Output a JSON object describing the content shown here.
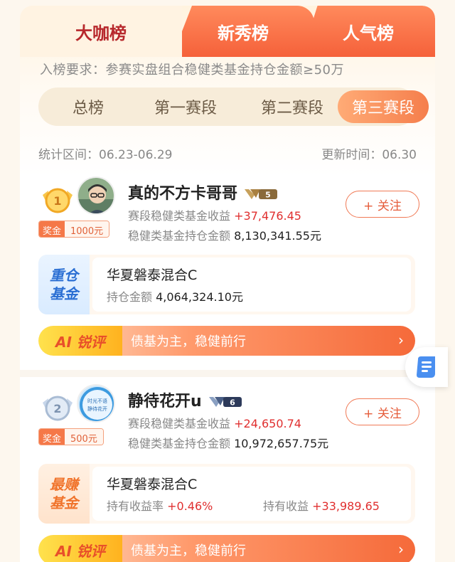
{
  "tabs": [
    {
      "label": "大咖榜",
      "active": true
    },
    {
      "label": "新秀榜",
      "active": false
    },
    {
      "label": "人气榜",
      "active": false
    }
  ],
  "requirement": "入榜要求：参赛实盘组合稳健类基金持仓金额≥50万",
  "segments": [
    "总榜",
    "第一赛段",
    "第二赛段",
    "第三赛段"
  ],
  "active_segment": "第三赛段",
  "stats": {
    "period": "统计区间：06.23-06.29",
    "updated": "更新时间：06.30"
  },
  "entries": [
    {
      "rank": "1",
      "prize_label": "奖金",
      "prize_amount": "1000元",
      "name": "真的不方卡哥哥",
      "level": "5",
      "return_label": "赛段稳健类基金收益",
      "return_value": "+37,476.45",
      "holding_label": "稳健类基金持仓金额",
      "holding_value": "8,130,341.55元",
      "follow_label": "+ 关注",
      "fund_tag": [
        "重仓",
        "基金"
      ],
      "fund_name": "华夏磐泰混合C",
      "fund_sub_label": "持仓金额",
      "fund_sub_value": "4,064,324.10元",
      "ai_tag": "AI 锐评",
      "ai_text": "债基为主，稳健前行"
    },
    {
      "rank": "2",
      "prize_label": "奖金",
      "prize_amount": "500元",
      "name": "静待花开u",
      "level": "6",
      "avatar_text": [
        "时光不语",
        "静待花开"
      ],
      "return_label": "赛段稳健类基金收益",
      "return_value": "+24,650.74",
      "holding_label": "稳健类基金持仓金额",
      "holding_value": "10,972,657.75元",
      "follow_label": "+ 关注",
      "fund_tag": [
        "最赚",
        "基金"
      ],
      "fund_name": "华夏磐泰混合C",
      "fund_sub_label": "持有收益率",
      "fund_sub_value": "+0.46%",
      "fund_sub2_label": "持有收益",
      "fund_sub2_value": "+33,989.65",
      "ai_tag": "AI 锐评",
      "ai_text": "债基为主，稳健前行"
    }
  ],
  "colors": {
    "accent": "#f5613a",
    "active_tab_text": "#b7282c",
    "positive": "#e02f2f"
  },
  "icons": {
    "arrow": "›",
    "float": "document-icon"
  }
}
